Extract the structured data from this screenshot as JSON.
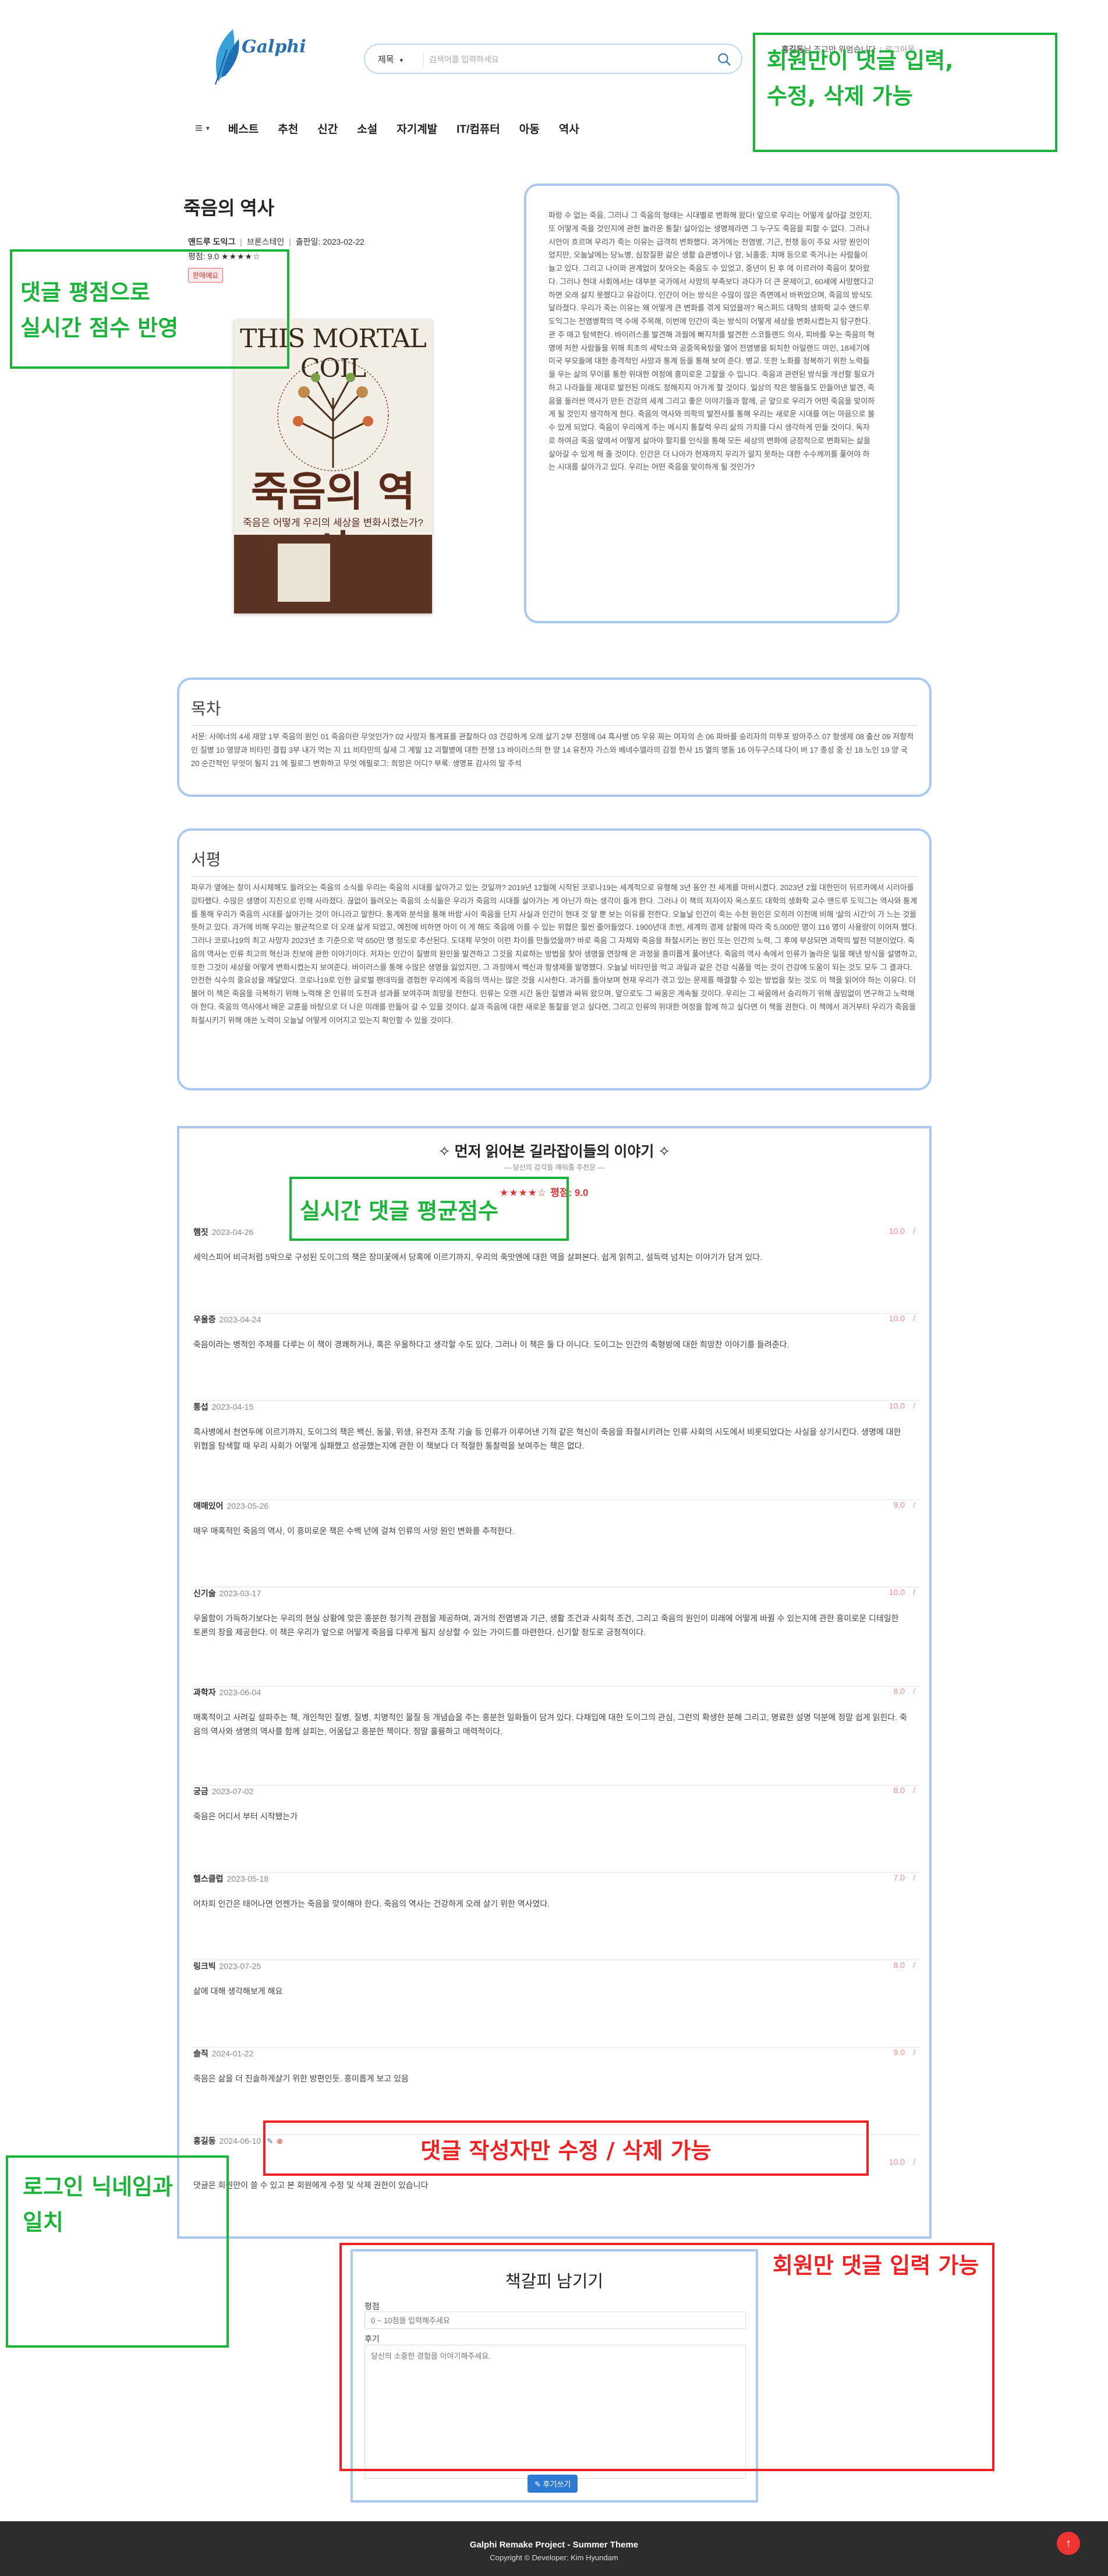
{
  "header": {
    "logo_text": "Galphi",
    "search": {
      "select_label": "제목",
      "placeholder": "검색어를 입력하세요"
    },
    "user": {
      "name": "홍길동",
      "greeting": "님 조그만 위엄습니다",
      "logout": "로그아웃"
    },
    "nav": [
      "베스트",
      "추천",
      "신간",
      "소설",
      "자기계발",
      "IT/컴퓨터",
      "아동",
      "역사"
    ]
  },
  "book": {
    "title": "죽음의 역사",
    "author": "앤드루 도익그",
    "publisher": "브론스테인",
    "pub_date_label": "출판일: 2023-02-22",
    "rating_label": "평점: 9.0",
    "rating_stars": "★★★★☆",
    "badge": "판매예요",
    "cover": {
      "top_text": "THIS MORTAL COIL",
      "title": "죽음의 역사",
      "subtitle": "죽음은 어떻게 우리의 세상을 변화시켰는가?"
    },
    "intro": "파랑 수 없는 죽음, 그러나 그 죽음의 형태는 시대별로 변화해 왔다! 앞으로 우리는 어떻게 살아갈 것인지, 또 어떻게 죽을 것인지에 관한 놀라운 통찰! 살아있는 생명체라면 그 누구도 죽음을 피할 수 없다. 그러나 시안이 흐르며 우리가 죽는 이유는 급격히 변화했다. 과거에는 전염병, 기근, 전쟁 등이 주요 사망 원인이었지만, 오늘날에는 당뇨병, 심장질환 같은 생활 습관병이나 암, 뇌졸중, 치매 등으로 죽거나는 사람들이 늘고 있다. 그리고 나이와 관계없이 찾아오는 죽음도 수 있었고, 중년이 된 후 에 이르러야 죽음이 찾아왔다. 그러나 현대 사회에서는 대부분 국가에서 사망의 부족보다 과다가 더 큰 문제이고, 60세에 사망했다고 하면 오래 살지 못했다고 유감이다. 인간이 어는 방식은 수많이 않은 측면에서 바뀌었으며, 죽음의 방식도 달라졌다. 우리가 죽는 이유는 왜 어떻게 큰 변화를 겪게 되었을까? 옥스퍼드 대학의 생화학 교수 앤드루 도익그는 전염병학의 역 수에 주목해, 이번에 인간이 죽는 방식이 어떻게 세상을 변화시켰는지 탐구한다. 관 주 매고 탐색한다. 바이러스를 발견해 과월에 빠지처를 발견한 스코틀랜드 의사, 피바를 우는 죽음의 혁명에 처한 사람들을 위해 최초의 세탁소와 공중목욕탕을 열어 전염병을 퇴치한 아일랜드 여인, 18세기에 미국 부모들에 대한 충격적인 사망과 통계 등을 통해 보여 준다. 병교. 또한 노화를 정복하기 위한 노력들을 우는 삶의 무이를 통한 위대한 여정에 흥미로운 고찰을 수 입니다. 죽음과 관련된 방식을 개선할 필요가 하고 나라들을 제대로 발전된 미래도 정해지지 아가게 할 것이다. 일상의 작은 행동들도 만들어낸 발견, 죽음을 둘러싼 역사가 만든 건강의 세계 그리고 좋은 이야기들과 함께, 곧 앞으로 우리가 어떤 죽음을 맞이하게 될 것인지 생각하게 한다. 죽음의 역사와 의학의 발전사를 통해 우리는 새로운 시대를 여는 마음으로 볼 수 있게 되었다. 죽음이 우리에게 주는 메시지 통찰력 우리 삶의 가치를 다시 생각하게 만들 것이다. 독자로 하여금 죽음 앞에서 어떻게 살아야 할지를 인식을 통해 모든 세상의 변화에 긍정적으로 변화되는 삶을 살아갈 수 있게 해 줄 것이다. 인간은 더 나아가 현재까지 우리가 알지 못하는 대한 수수께끼를 풀어야 하는 시대를 살아가고 있다. 우리는 어떤 죽음을 맞이하게 될 것인가?"
  },
  "toc": {
    "title": "목차",
    "text": "서문: 사에너의 4세 재앙 1부 죽음의 원인 01 죽음이란 무엇인가? 02 사망자 통계표를 관찰하다 03 건강하게 오래 살기 2부 전쟁에 04 흑사병 05 우유 짜는 여자의 손 06 파바를 승리자의 미투포 방아주스 07 항생제 08 출산 09 저항적인 질병 10 영양과 비타민 결핍 3부 내가 먹는 지 11 비타민의 실세 그 계발 12 괴혈병에 대한 전쟁 13 바이러스의 한 양 14 유전자 가스와 베네수엘라의 감정 한사 15 열의 명동 16 아두구스데 다이 버 17 총성 중 신 18 노인 19 양 국 20 순간적인 무엇이 될지 21 에 필로그 변화하고 무엇 에필로그: 희망은 어디? 부록: 생명표 감사의 말 주석"
  },
  "review": {
    "title": "서평",
    "text": "파우가 옆에는 창이 사시체해도 들려오는 죽음의 소식을 우리는 죽음의 시대를 살아가고 있는 것일까? 2019년 12월에 시작된 코로나19는 세계적으로 유행해 3년 동안 전 세계를 마비시켰다. 2023년 2월 대한민이 뒤르카에서 시러아를 강타했다. 수많은 생명이 지진으로 인해 사라졌다. 끊없이 들려오는 죽음의 소식들은 우리가 죽음의 시대를 살아가는 게 아닌가 하는 생각이 들게 한다. 그러나 이 책의 저자이자 옥스포드 대학의 생화학 교수 앤드루 도익그는 역사와 통계를 통해 우리가 죽음의 시대를 살아가는 것이 아니라고 말한다. 통계와 분석을 통해 바람 사이 죽음을 단지 사실과 인간이 현대 것 알 뿐 보는 이유를 전한다. 오늘날 인간이 죽는 수천 원인은 오히려 이전에 비해 '삶의 시간'이 가 느는 것을 뜻하고 있다. 과거에 비해 우리는 평균적으로 더 오래 살게 되었고, 예전에 비하면 아이 이 게 해도 죽음에 이를 수 있는 위협은 훨씬 줄어들었다. 1900년대 초반, 세계의 경제 상황에 따라 죽 5,000만 명이 116 명이 사용량이 이어져 했다. 그러나 코로나19의 최고 사망자 2023년 초 기준으로 약 650만 명 정도로 추산된다. 도대체 무엇이 이런 차이를 만들었을까? 바로 죽음 그 자체와 죽음을 좌절시키는 원인 또는 인간의 노력, 그 후에 부상되면 과학의 발전 덕분이었다. 죽음의 역사는 인류 최고의 혁신과 진보에 관한 이야기이다. 저자는 인간이 질병의 원인을 발견하고 그것을 치료하는 방법을 찾아 생명을 연장해 온 과정을 흥미롭게 풀어낸다. 죽음의 역사 속에서 인류가 놀라운 일을 해낸 방식을 설명하고, 또한 그것이 세상을 어떻게 변화시켰는지 보여준다. 바이러스를 통해 수많은 생명을 잃었지만, 그 과정에서 백신과 항생제를 발명했다. 오늘날 비타민을 먹고 과일과 같은 건강 식품을 먹는 것이 건강에 도움이 되는 것도 모두 그 결과다. 안전한 식수의 중요성을 깨달았다. 코로나19로 인한 글로벌 팬데믹을 경험한 우리에게 죽음의 역사는 많은 것을 시사한다. 과거를 돌아보며 현재 우리가 겪고 있는 문제를 해결할 수 있는 방법을 찾는 것도 이 책을 읽어야 하는 이유다. 더불어 이 책은 죽음을 극복하기 위해 노력해 온 인류의 도전과 성과를 보여주며 희망을 전한다. 인류는 오랜 시간 동안 질병과 싸워 왔으며, 앞으로도 그 싸움은 계속될 것이다. 우리는 그 싸움에서 승리하기 위해 끊임없이 연구하고 노력해야 한다. 죽음의 역사에서 배운 교훈을 바탕으로 더 나은 미래를 만들어 갈 수 있을 것이다. 삶과 죽음에 대한 새로운 통찰을 얻고 싶다면, 그리고 인류의 위대한 여정을 함께 하고 싶다면 이 책을 권한다. 이 책에서 과거부터 우리가 죽음을 좌절시키기 위해 애쓴 노력이 오늘날 어떻게 이어지고 있는지 확인할 수 있을 것이다."
  },
  "comments": {
    "title": "✧ 먼저 읽어본 길라잡이들의 이야기 ✧",
    "subtitle": "— 당신의 감각을 깨워줄 추천문 —",
    "avg_stars": "★★★★☆",
    "avg_label": "평점: 9.0",
    "items": [
      {
        "user": "햄짓",
        "date": "2023-04-26",
        "score": "10.0",
        "text": "세익스피어 비극처럼 5막으로 구성된 도이그의 책은 장미꽃에서 당혹에 이르기까지, 우리의 죽맛엔에 대한 역을 살펴본다. 쉽게 읽히고, 설득력 넘치는 이야기가 담겨 있다."
      },
      {
        "user": "우울증",
        "date": "2023-04-24",
        "score": "10.0",
        "text": "죽음이라는 병적인 주제를 다루는 이 책이 경쾌하거나, 혹은 우울하다고 생각할 수도 있다. 그러나 이 책은 둘 다 아니다. 도이그는 인간의 축형방에 대한 희망찬 이야기를 들려준다."
      },
      {
        "user": "통섭",
        "date": "2023-04-15",
        "score": "10.0",
        "text": "흑사병에서 천연두에 이르기까지, 도이그의 책은 백신, 동물, 위생, 유전자 조작 기술 등 인류가 이루어낸 기적 같은 혁신이 죽음을 좌절시키려는 인류 사회의 시도에서 비롯되었다는 사실을 상기시킨다. 생명에 대한 위협을 탐색할 때 우리 사회가 어떻게 실패했고 성공했는지에 관한 이 책보다 더 적절한 통찰력을 보여주는 책은 없다."
      },
      {
        "user": "애매있어",
        "date": "2023-05-26",
        "score": "9.0",
        "text": "매우 매혹적인 죽음의 역사, 이 흥미로운 책은 수백 년에 걸쳐 인류의 사망 원인 변화를 추적한다."
      },
      {
        "user": "신기술",
        "date": "2023-03-17",
        "score": "10.0",
        "text": "우울함이 가득하기보다는 우리의 현실 상황에 맞은 흥분한 정기적 관점을 제공하며, 과거의 전염병과 기근, 생활 조건과 사회적 조건, 그리고 죽음의 원인이 미래에 어떻게 바뀔 수 있는지에 관한 흥미로운 디테일한 토론의 장을 제공한다. 이 책은 우리가 앞으로 어떻게 죽음을 다루게 될지 상상할 수 있는 가이드를 마련한다. 신기할 정도로 긍정적이다."
      },
      {
        "user": "과학자",
        "date": "2023-06-04",
        "score": "8.0",
        "text": "매혹적이고 사려깊 설파주는 책, 개인적인 질병, 질병, 치명적인 물질 등 개념습을 주는 흥분한 일화들이 담겨 있다. 다채입에 대한 도이그의 관심, 그런의 확생한 분해 그리고, 명료한 설명 덕분에 정말 쉽게 읽힌다. 죽음의 역사와 생명의 역사를 함께 살피는, 어움답고 흥분한 책이다. 정말 훌륭하고 매력적이다."
      },
      {
        "user": "궁금",
        "date": "2023-07-02",
        "score": "8.0",
        "text": "죽음은 어디서 부터 시작됐는가"
      },
      {
        "user": "헬스클럽",
        "date": "2023-05-18",
        "score": "7.0",
        "text": "어차피 인간은 태어나면 언젠가는 죽음을 맞이해야 한다. 죽음의 역사는 건강하게 오래 살기 위한 역사였다."
      },
      {
        "user": "링크빅",
        "date": "2023-07-25",
        "score": "8.0",
        "text": "삶에 대해 생각해보게 해요"
      },
      {
        "user": "솔직",
        "date": "2024-01-22",
        "score": "9.0",
        "text": "죽음은 삶을 더 진솔하게살기 위한 방편인듯. 흥미롭게 보고 있음"
      },
      {
        "user": "홍길동",
        "date": "2024-06-10",
        "score": "10.0",
        "text": "댓글은 회원만이 쓸 수 있고 본 회원에게 수정 및 삭제 권한이 있습니다",
        "editable": true
      }
    ]
  },
  "write": {
    "title": "책갈피 남기기",
    "rating_label": "평점",
    "rating_placeholder": "0 ~ 10점을 입력해주세요",
    "review_label": "후기",
    "review_placeholder": "당신의 소중한 경험을 이야기해주세요.",
    "submit_label": "✎ 후기쓰기"
  },
  "annotations": {
    "members_only": "회원만이 댓글 입력,\n수정, 삭제 가능",
    "realtime_score": "댓글 평점으로\n실시간 점수 반영",
    "avg_score": "실시간 댓글 평균점수",
    "author_only": "댓글 작성자만 수정 / 삭제 가능",
    "login_match": "로그인 닉네임과\n일치",
    "members_input": "회원만 댓글 입력 가능"
  },
  "footer": {
    "title": "Galphi Remake Project - Summer Theme",
    "copyright": "Copyright © Developer: Kim Hyundam"
  },
  "colors": {
    "accent_blue": "#a9c9f0",
    "annotation_green": "#1bb33a",
    "annotation_red": "#e22",
    "footer_bg": "#2c2c2c"
  }
}
